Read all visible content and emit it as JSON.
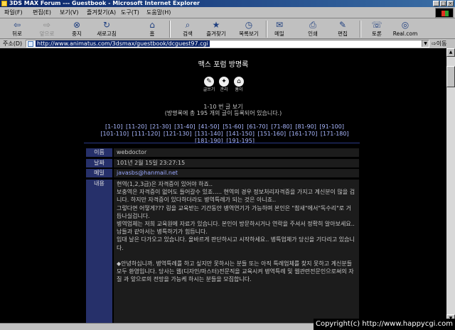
{
  "window": {
    "title": "3DS MAX Forum --- Guestbook - Microsoft Internet Explorer",
    "controls": [
      "_",
      "□",
      "×"
    ]
  },
  "menu": [
    "파일(F)",
    "편집(E)",
    "보기(V)",
    "즐겨찾기(A)",
    "도구(T)",
    "도움말(H)"
  ],
  "toolbar": [
    {
      "label": "뒤로",
      "icon": "back-arrow-icon",
      "glyph": "⇦"
    },
    {
      "label": "앞으로",
      "icon": "forward-arrow-icon",
      "glyph": "⇨"
    },
    {
      "label": "중지",
      "icon": "stop-icon",
      "glyph": "⊗"
    },
    {
      "label": "새로고침",
      "icon": "refresh-icon",
      "glyph": "↻"
    },
    {
      "label": "홈",
      "icon": "home-icon",
      "glyph": "⌂"
    },
    {
      "label": "검색",
      "icon": "search-icon",
      "glyph": "⌕"
    },
    {
      "label": "즐겨찾기",
      "icon": "favorites-icon",
      "glyph": "★"
    },
    {
      "label": "목록보기",
      "icon": "history-icon",
      "glyph": "◷"
    },
    {
      "label": "메일",
      "icon": "mail-icon",
      "glyph": "✉"
    },
    {
      "label": "인쇄",
      "icon": "print-icon",
      "glyph": "⎙"
    },
    {
      "label": "편집",
      "icon": "edit-icon",
      "glyph": "✎"
    },
    {
      "label": "토론",
      "icon": "discuss-icon",
      "glyph": "☏"
    },
    {
      "label": "Real.com",
      "icon": "realcom-icon",
      "glyph": "◎"
    }
  ],
  "address": {
    "label": "주소(D)",
    "url": "http://www.animatus.com/3dsmax/guestbook/dcguest97.cgi",
    "go": "이동"
  },
  "page": {
    "title": "맥스 포럼 방명록",
    "nav": [
      {
        "label": "글쓰기",
        "icon": "write-icon",
        "glyph": "✎"
      },
      {
        "label": "관리",
        "icon": "admin-icon",
        "glyph": "✦"
      },
      {
        "label": "홈이",
        "icon": "home-icon",
        "glyph": "⌂"
      }
    ],
    "info_line1": "1-10 번 글 보기",
    "info_line2": "(방명록에 총 195 개의 글이 등록되어 있습니다.)",
    "page_links": [
      "[1-10]",
      "[11-20]",
      "[21-30]",
      "[31-40]",
      "[41-50]",
      "[51-60]",
      "[61-70]",
      "[71-80]",
      "[81-90]",
      "[91-100]",
      "[101-110]",
      "[111-120]",
      "[121-130]",
      "[131-140]",
      "[141-150]",
      "[151-160]",
      "[161-170]",
      "[171-180]",
      "[181-190]",
      "[191-195]"
    ],
    "entry": {
      "name_label": "이름",
      "name": "webdoctor",
      "date_label": "날짜",
      "date": "101년 2월 15일 23:27:15",
      "mail_label": "메일",
      "mail": "javasbs@hanmail.net",
      "body_label": "내용",
      "body_lines": [
        "현역(1,2,3급)은 자격증이 있어야 하죠..",
        "보충역은 자격증이 없어도 들어갈수 있죠..... 현역의 경우 정보처리자격증을 가지고 계신분이 많을 겁니다. 하지만 자격증이 있다하더라도 병역특례가 되는 것은 아니죠..",
        "그렇다면 어떻게??? 링을 교육받는 기간동안 병역연기가 가능하며 본인은 \"참새\"에서\"독수리\"로 거듭나실겁니다.",
        "병역업체는 저희 교육원에 자료가 있습니다. 본인이 방문하시거나 연락을 주셔서 정확히 알아보세요..",
        "남들과 같아서는 병특하기가 힘듭니다.",
        "입대 날은 다가오고 있습니다. 올바르게 판단하시고 시작하세요.. 병특업체가 당신을 기다리고 있습니다.",
        "",
        "◆안녕하십니까. 병역특례를 하고 싶지만 못하시는 분들 또는 아직 특례업체를 찾지 못하고 계신분들 모두 환영입니다. 당사는 웹(디자인/마스터)전문직을 교육시켜 병역특례 및 웹관련전문인으로써의 자질 과 앞으로의 전망을 가능케 하시는 분들을 모집합니다."
      ]
    }
  },
  "copyright": "Copyright(c) http://www.happycgi.com",
  "colors": {
    "page_bg": "#000000",
    "label_bg": "#26306a",
    "value_bg": "#1c1c1c",
    "link": "#9aa8ff"
  }
}
